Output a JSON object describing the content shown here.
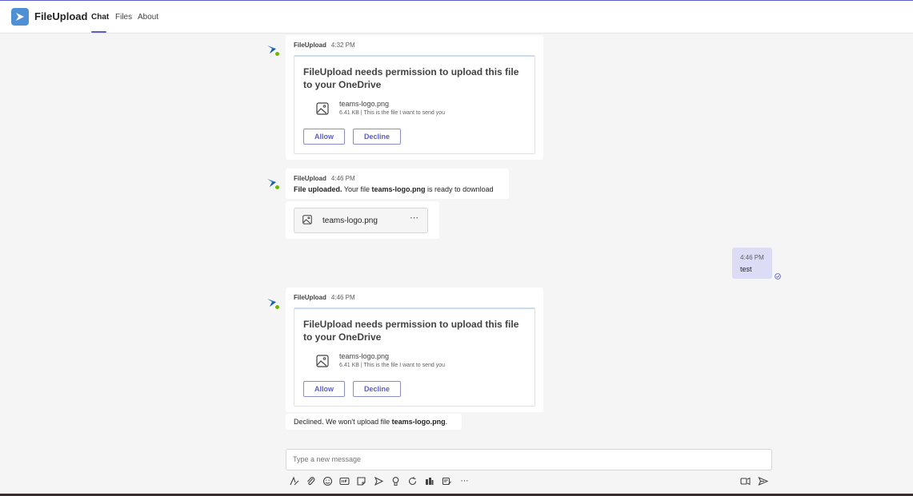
{
  "app": {
    "title": "FileUpload"
  },
  "tabs": [
    {
      "label": "Chat"
    },
    {
      "label": "Files"
    },
    {
      "label": "About"
    }
  ],
  "messages": [
    {
      "sender": "FileUpload",
      "time": "4:32 PM",
      "card": {
        "title": "FileUpload needs permission to upload this file to your OneDrive",
        "file_name": "teams-logo.png",
        "file_desc": "6.41 KB | This is the file I want to send you",
        "allow_label": "Allow",
        "decline_label": "Decline"
      }
    },
    {
      "sender": "FileUpload",
      "time": "4:46 PM",
      "text_bold_1": "File uploaded.",
      "text_part_2": " Your file ",
      "text_bold_2": "teams-logo.png",
      "text_part_3": " is ready to download",
      "attachment": {
        "file_name": "teams-logo.png",
        "more": "⋯"
      }
    },
    {
      "sender": "FileUpload",
      "time": "4:46 PM",
      "card": {
        "title": "FileUpload needs permission to upload this file to your OneDrive",
        "file_name": "teams-logo.png",
        "file_desc": "6.41 KB | This is the file I want to send you",
        "allow_label": "Allow",
        "decline_label": "Decline"
      },
      "followup_part_1": "Declined. We won't upload file ",
      "followup_bold": "teams-logo.png",
      "followup_part_2": "."
    }
  ],
  "my_message": {
    "time": "4:46 PM",
    "text": "test"
  },
  "compose": {
    "placeholder": "Type a new message",
    "more_label": "⋯"
  },
  "colors": {
    "accent": "#5b5fc7",
    "bubble_self": "#dcdcf7",
    "presence": "#6bb700"
  }
}
